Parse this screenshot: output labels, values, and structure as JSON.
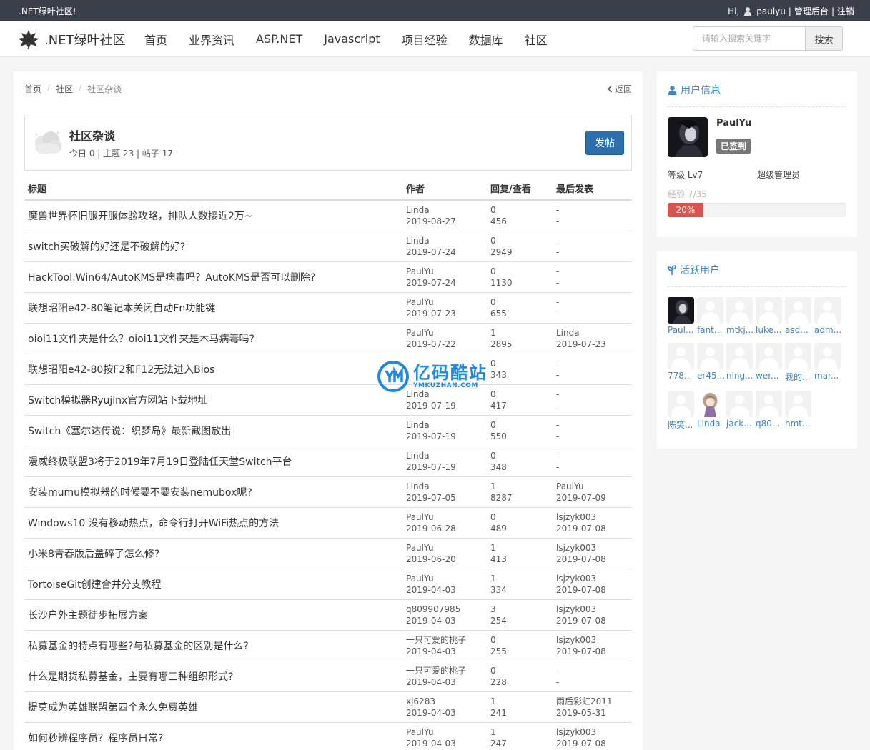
{
  "topbar": {
    "welcome": ".NET绿叶社区!",
    "greeting": "Hi,",
    "username": "paulyu",
    "sep1": "|",
    "admin_link": "管理后台",
    "sep2": "|",
    "logout_link": "注销"
  },
  "navbar": {
    "brand": ".NET绿叶社区",
    "items": [
      "首页",
      "业界资讯",
      "ASP.NET",
      "Javascript",
      "项目经验",
      "数据库",
      "社区"
    ],
    "search_placeholder": "请输入搜索关键字",
    "search_button": "搜索"
  },
  "breadcrumb": {
    "items": [
      "首页",
      "社区",
      "社区杂谈"
    ],
    "sep": "/",
    "back": "返回"
  },
  "forum": {
    "name": "社区杂谈",
    "stats": "今日 0 | 主题 23 | 帖子 17",
    "post_button": "发帖"
  },
  "table": {
    "headers": [
      "标题",
      "作者",
      "回复/查看",
      "最后发表"
    ],
    "rows": [
      {
        "title": "魔兽世界怀旧服开服体验攻略，排队人数接近2万~",
        "author": "Linda",
        "date": "2019-08-27",
        "replies": "0",
        "views": "456",
        "last_user": "-",
        "last_date": "-"
      },
      {
        "title": "switch买破解的好还是不破解的好?",
        "author": "Linda",
        "date": "2019-07-24",
        "replies": "0",
        "views": "2949",
        "last_user": "-",
        "last_date": "-"
      },
      {
        "title": "HackTool:Win64/AutoKMS是病毒吗？AutoKMS是否可以删除?",
        "author": "PaulYu",
        "date": "2019-07-24",
        "replies": "0",
        "views": "1130",
        "last_user": "-",
        "last_date": "-"
      },
      {
        "title": "联想昭阳e42-80笔记本关闭自动Fn功能键",
        "author": "PaulYu",
        "date": "2019-07-23",
        "replies": "0",
        "views": "655",
        "last_user": "-",
        "last_date": "-"
      },
      {
        "title": "oioi11文件夹是什么？oioi11文件夹是木马病毒吗?",
        "author": "PaulYu",
        "date": "2019-07-22",
        "replies": "1",
        "views": "2895",
        "last_user": "Linda",
        "last_date": "2019-07-23"
      },
      {
        "title": "联想昭阳e42-80按F2和F12无法进入Bios",
        "author": "",
        "date": "",
        "replies": "0",
        "views": "343",
        "last_user": "-",
        "last_date": "-"
      },
      {
        "title": "Switch模拟器Ryujinx官方网站下载地址",
        "author": "Linda",
        "date": "2019-07-19",
        "replies": "0",
        "views": "417",
        "last_user": "-",
        "last_date": "-"
      },
      {
        "title": "Switch《塞尔达传说：织梦岛》最新截图放出",
        "author": "Linda",
        "date": "2019-07-19",
        "replies": "0",
        "views": "550",
        "last_user": "-",
        "last_date": "-"
      },
      {
        "title": "漫威终极联盟3将于2019年7月19日登陆任天堂Switch平台",
        "author": "Linda",
        "date": "2019-07-19",
        "replies": "0",
        "views": "348",
        "last_user": "-",
        "last_date": "-"
      },
      {
        "title": "安装mumu模拟器的时候要不要安装nemubox呢?",
        "author": "Linda",
        "date": "2019-07-05",
        "replies": "1",
        "views": "8287",
        "last_user": "PaulYu",
        "last_date": "2019-07-09"
      },
      {
        "title": "Windows10 没有移动热点，命令行打开WiFi热点的方法",
        "author": "PaulYu",
        "date": "2019-06-28",
        "replies": "0",
        "views": "489",
        "last_user": "lsjzyk003",
        "last_date": "2019-07-08"
      },
      {
        "title": "小米8青春版后盖碎了怎么修?",
        "author": "PaulYu",
        "date": "2019-06-20",
        "replies": "1",
        "views": "413",
        "last_user": "lsjzyk003",
        "last_date": "2019-07-08"
      },
      {
        "title": "TortoiseGit创建合并分支教程",
        "author": "PaulYu",
        "date": "2019-04-03",
        "replies": "1",
        "views": "334",
        "last_user": "lsjzyk003",
        "last_date": "2019-07-08"
      },
      {
        "title": "长沙户外主题徒步拓展方案",
        "author": "q809907985",
        "date": "2019-04-03",
        "replies": "3",
        "views": "254",
        "last_user": "lsjzyk003",
        "last_date": "2019-07-08"
      },
      {
        "title": "私募基金的特点有哪些?与私募基金的区别是什么?",
        "author": "一只可爱的桃子",
        "date": "2019-04-03",
        "replies": "0",
        "views": "255",
        "last_user": "lsjzyk003",
        "last_date": "2019-07-08"
      },
      {
        "title": "什么是期货私募基金，主要有哪三种组织形式?",
        "author": "一只可爱的桃子",
        "date": "2019-04-03",
        "replies": "0",
        "views": "228",
        "last_user": "-",
        "last_date": "-"
      },
      {
        "title": "提莫成为英雄联盟第四个永久免费英雄",
        "author": "xj6283",
        "date": "2019-04-03",
        "replies": "1",
        "views": "241",
        "last_user": "雨后彩虹2011",
        "last_date": "2019-05-31"
      },
      {
        "title": "如何秒辨程序员？程序员日常?",
        "author": "PaulYu",
        "date": "2019-04-03",
        "replies": "1",
        "views": "247",
        "last_user": "lsjzyk003",
        "last_date": "2019-07-08"
      }
    ]
  },
  "user_panel": {
    "heading": "用户信息",
    "name": "PaulYu",
    "signed_badge": "已签到",
    "level": "等级 Lv7",
    "role": "超级管理员",
    "exp": "经验 7/35",
    "progress_percent": 20,
    "progress_label": "20%",
    "accent_color": "#3a87c8",
    "progress_color": "#d9534f"
  },
  "active_users": {
    "heading": "活跃用户",
    "users": [
      {
        "name": "Paul...",
        "avatar": "dark-photo"
      },
      {
        "name": "fant...",
        "avatar": "default"
      },
      {
        "name": "mtkj...",
        "avatar": "default"
      },
      {
        "name": "luke...",
        "avatar": "default"
      },
      {
        "name": "asd...",
        "avatar": "default"
      },
      {
        "name": "adm...",
        "avatar": "default"
      },
      {
        "name": "778...",
        "avatar": "default"
      },
      {
        "name": "er45...",
        "avatar": "default"
      },
      {
        "name": "ning...",
        "avatar": "default"
      },
      {
        "name": "wer...",
        "avatar": "default"
      },
      {
        "name": "我的...",
        "avatar": "default"
      },
      {
        "name": "mar...",
        "avatar": "default"
      },
      {
        "name": "陈笑...",
        "avatar": "default"
      },
      {
        "name": "Linda",
        "avatar": "anime-girl"
      },
      {
        "name": "jack...",
        "avatar": "default"
      },
      {
        "name": "q80...",
        "avatar": "default"
      },
      {
        "name": "hmt...",
        "avatar": "default"
      }
    ]
  },
  "watermark": {
    "title": "亿码酷站",
    "subtitle": "YMKUZHAN.COM"
  }
}
